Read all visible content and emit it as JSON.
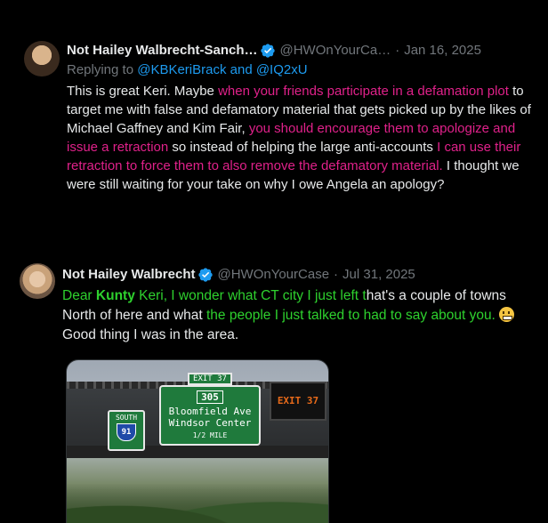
{
  "tweet1": {
    "name": "Not Hailey Walbrecht-Sanch…",
    "handle": "@HWOnYourCa…",
    "separator": "·",
    "date": "Jan 16, 2025",
    "replying_prefix": "Replying to",
    "replying_users": "@KBKeriBrack and @IQ2xU",
    "body": {
      "p1": "This is great Keri. Maybe ",
      "p2": "when your friends participate in a defamation plot",
      "p3": " to target me with false and defamatory material that gets picked up by the likes of Michael Gaffney and Kim Fair, ",
      "p4": "you should encourage them to apologize and issue a retraction",
      "p5": " so instead of helping the large anti-accounts ",
      "p6": "I can use their retraction to force them to also remove the defamatory material.",
      "p7": " I thought we were still waiting for your take on why I owe Angela an apology?"
    }
  },
  "tweet2": {
    "name": "Not Hailey Walbrecht",
    "handle": "@HWOnYourCase",
    "separator": "·",
    "date": "Jul 31, 2025",
    "body": {
      "p1": "Dear ",
      "p2": "Kunty",
      "p3": " Keri, I wonder what CT city I just left t",
      "p4": "hat's a couple of towns North of here and what ",
      "p5": "the people I just talked to had to say about you.",
      "p6": " ",
      "p7": "Good thing I was in the area."
    },
    "emoji": "grimacing-face",
    "media": {
      "exit_tab": "EXIT 37",
      "route": "305",
      "line1": "Bloomfield Ave",
      "line2": "Windsor Center",
      "distance": "1/2 MILE",
      "small_sign_dir": "SOUTH",
      "small_sign_route": "91",
      "vms_text": "EXIT 37"
    }
  },
  "colors": {
    "background": "#000000",
    "text": "#e7e9ea",
    "muted": "#71767b",
    "link": "#1d9bf0",
    "highlight_pink": "#e0218a",
    "highlight_green": "#2ed12e",
    "verified": "#1d9bf0"
  }
}
